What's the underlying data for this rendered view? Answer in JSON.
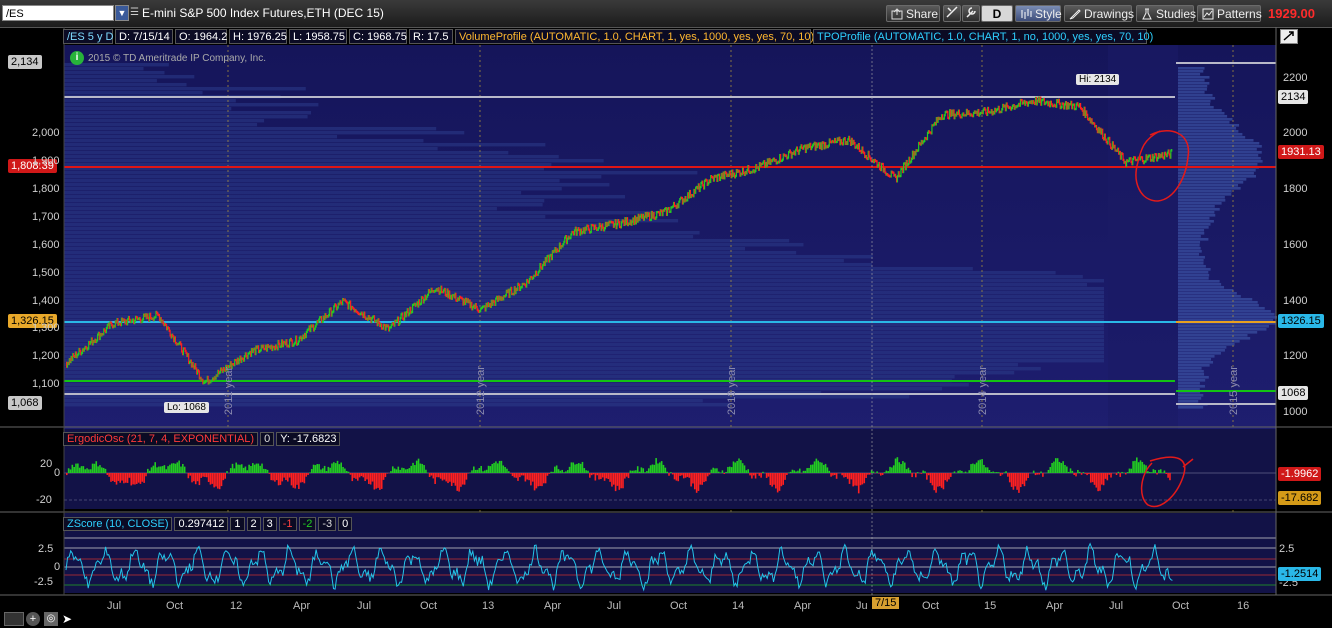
{
  "toolbar": {
    "symbol": "/ES",
    "instrument_desc": "E-mini S&P 500 Index Futures,ETH (DEC 15)",
    "share_label": "Share",
    "period_label": "D",
    "style_label": "Style",
    "drawings_label": "Drawings",
    "studies_label": "Studies",
    "patterns_label": "Patterns",
    "last_price": "1929.00"
  },
  "info": {
    "symbol_period": "/ES 5 y D",
    "date": "D: 7/15/14",
    "open": "O: 1964.2",
    "high": "H: 1976.25",
    "low": "L: 1958.75",
    "close": "C: 1968.75",
    "range": "R: 17.5",
    "volume_profile": "VolumeProfile (AUTOMATIC, 1.0, CHART, 1, yes, 1000, yes, yes, 70, 10)",
    "tpo_profile": "TPOProfile (AUTOMATIC, 1.0, CHART, 1, no, 1000, yes, yes, 70, 10)",
    "copyright": "2015 © TD Ameritrade IP Company, Inc.",
    "info_icon": "i"
  },
  "price_panel": {
    "hi_label": "Hi: 2134",
    "lo_label": "Lo: 1068",
    "left_labels": {
      "top": "2,134",
      "red": "1,808.39",
      "orange": "1,326.15",
      "bottom": "1,068"
    },
    "left_ticks": [
      "2,000",
      "1,900",
      "1,800",
      "1,700",
      "1,600",
      "1,500",
      "1,400",
      "1,300",
      "1,200",
      "1,100"
    ],
    "right_ticks": [
      "2200",
      "2000",
      "1800",
      "1600",
      "1400",
      "1200",
      "1000"
    ],
    "right_labels": {
      "hi": "2134",
      "last": "1931.13",
      "poc": "1326.15",
      "lo": "1068"
    },
    "year_markers": [
      "2011 year",
      "2012 year",
      "2013 year",
      "2014 year",
      "2015 year"
    ]
  },
  "ergodic_panel": {
    "title": "ErgodicOsc (21, 7, 4, EXPONENTIAL)",
    "zero": "0",
    "value": "Y: -17.6823",
    "left_ticks": [
      "20",
      "0",
      "-20"
    ],
    "right_value": "-1.9962",
    "right_value2": "-17.682"
  },
  "zscore_panel": {
    "title": "ZScore (10, CLOSE)",
    "value": "0.297412",
    "levels": [
      "1",
      "2",
      "3",
      "-1",
      "-2",
      "-3",
      "0"
    ],
    "left_ticks": [
      "2.5",
      "0",
      "-2.5"
    ],
    "right_ticks": [
      "2.5",
      "-2.5"
    ],
    "right_value": "-1.2514"
  },
  "x_axis": {
    "labels": [
      "Jul",
      "Oct",
      "12",
      "Apr",
      "Jul",
      "Oct",
      "13",
      "Apr",
      "Jul",
      "Oct",
      "14",
      "Apr",
      "Ju",
      "Oct",
      "15",
      "Apr",
      "Jul",
      "Oct",
      "16"
    ],
    "cursor_label": "7/15"
  },
  "colors": {
    "up": "#22cc22",
    "down": "#ff2020",
    "background": "#1a1a5e",
    "profile": "#2b3d8a",
    "hi_line": "#b9b9c9",
    "red_line": "#e01515",
    "cyan_line": "#2ab8e8",
    "green_line": "#13c313"
  },
  "chart_data": {
    "type": "line",
    "title": "/ES 5 y D",
    "series": [
      {
        "name": "",
        "x": [
          "2010-10",
          "2011-02",
          "2011-05",
          "2011-08",
          "2011-10",
          "2011-12",
          "2012-03",
          "2012-06",
          "2012-09",
          "2012-11",
          "2013-01",
          "2013-05",
          "2013-07",
          "2013-10",
          "2014-01",
          "2014-03",
          "2014-06",
          "2014-08",
          "2014-10",
          "2014-12",
          "2015-03",
          "2015-05",
          "2015-07",
          "2015-08",
          "2015-09"
        ],
        "values": [
          1180,
          1320,
          1350,
          1110,
          1220,
          1260,
          1400,
          1300,
          1450,
          1370,
          1470,
          1650,
          1680,
          1720,
          1840,
          1880,
          1950,
          1980,
          1840,
          2070,
          2080,
          2120,
          2100,
          1900,
          1930
        ]
      }
    ],
    "ylim": [
      1000,
      2240
    ],
    "levels": {
      "hi": 2134,
      "lo": 1068,
      "red": 1808.39,
      "poc": 1326.15,
      "green": 1118
    }
  }
}
